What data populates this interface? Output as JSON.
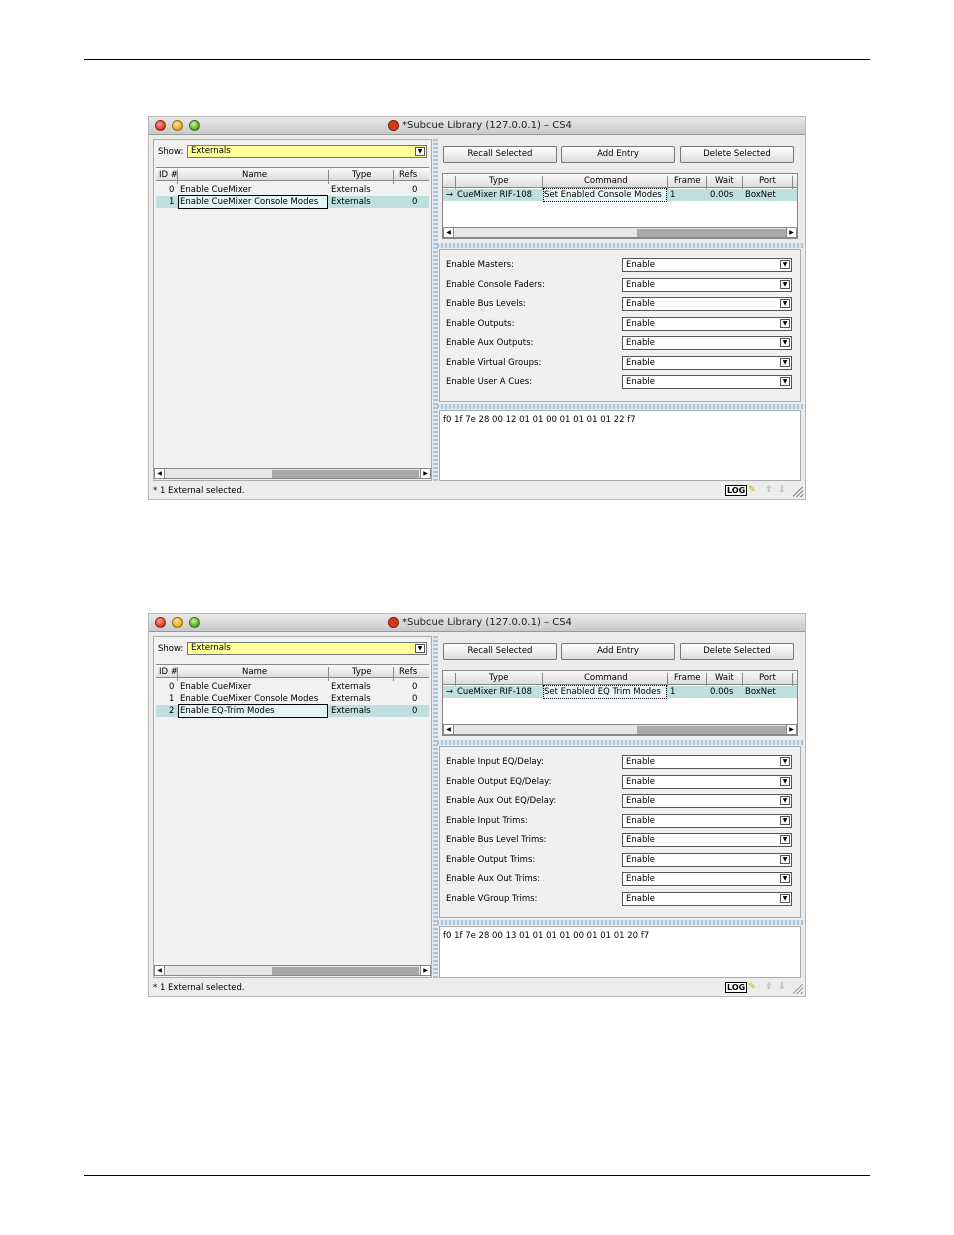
{
  "windows": [
    {
      "title": "*Subcue Library (127.0.0.1) – CS4",
      "show": {
        "label": "Show:",
        "value": "Externals"
      },
      "left_columns": [
        "ID #",
        "Name",
        "Type",
        "Refs"
      ],
      "left_rows": [
        {
          "id": "0",
          "name": "Enable CueMixer",
          "type": "Externals",
          "refs": "0"
        },
        {
          "id": "1",
          "name": "Enable CueMixer Console Modes",
          "type": "Externals",
          "refs": "0"
        }
      ],
      "buttons": [
        "Recall Selected",
        "Add Entry",
        "Delete Selected"
      ],
      "right_columns": [
        "Type",
        "Command",
        "Frame",
        "Wait",
        "Port"
      ],
      "right_row": {
        "arrow": "→",
        "type": "CueMixer RIF-108",
        "command": "Set Enabled Console Modes",
        "frame": "1",
        "wait": "0.00s",
        "port": "BoxNet"
      },
      "fields": [
        {
          "label": "Enable Masters:",
          "value": "Enable"
        },
        {
          "label": "Enable Console Faders:",
          "value": "Enable"
        },
        {
          "label": "Enable Bus Levels:",
          "value": "Enable"
        },
        {
          "label": "Enable Outputs:",
          "value": "Enable"
        },
        {
          "label": "Enable Aux Outputs:",
          "value": "Enable"
        },
        {
          "label": "Enable Virtual Groups:",
          "value": "Enable"
        },
        {
          "label": "Enable User A Cues:",
          "value": "Enable"
        }
      ],
      "hex": "f0 1f 7e 28 00 12 01 01 00 01 01 01 01 22 f7",
      "status": "* 1 External selected.",
      "log_label": "LOG"
    },
    {
      "title": "*Subcue Library (127.0.0.1) – CS4",
      "show": {
        "label": "Show:",
        "value": "Externals"
      },
      "left_columns": [
        "ID #",
        "Name",
        "Type",
        "Refs"
      ],
      "left_rows": [
        {
          "id": "0",
          "name": "Enable CueMixer",
          "type": "Externals",
          "refs": "0"
        },
        {
          "id": "1",
          "name": "Enable CueMixer Console Modes",
          "type": "Externals",
          "refs": "0"
        },
        {
          "id": "2",
          "name": "Enable EQ-Trim Modes",
          "type": "Externals",
          "refs": "0"
        }
      ],
      "buttons": [
        "Recall Selected",
        "Add Entry",
        "Delete Selected"
      ],
      "right_columns": [
        "Type",
        "Command",
        "Frame",
        "Wait",
        "Port"
      ],
      "right_row": {
        "arrow": "→",
        "type": "CueMixer RIF-108",
        "command": "Set Enabled EQ Trim Modes",
        "frame": "1",
        "wait": "0.00s",
        "port": "BoxNet"
      },
      "fields": [
        {
          "label": "Enable Input EQ/Delay:",
          "value": "Enable"
        },
        {
          "label": "Enable Output EQ/Delay:",
          "value": "Enable"
        },
        {
          "label": "Enable Aux Out EQ/Delay:",
          "value": "Enable"
        },
        {
          "label": "Enable Input Trims:",
          "value": "Enable"
        },
        {
          "label": "Enable Bus Level Trims:",
          "value": "Enable"
        },
        {
          "label": "Enable Output Trims:",
          "value": "Enable"
        },
        {
          "label": "Enable Aux Out Trims:",
          "value": "Enable"
        },
        {
          "label": "Enable VGroup Trims:",
          "value": "Enable"
        }
      ],
      "hex": "f0 1f 7e 28 00 13 01 01 01 01 00 01 01 01 20 f7",
      "status": "* 1 External selected.",
      "log_label": "LOG"
    }
  ]
}
